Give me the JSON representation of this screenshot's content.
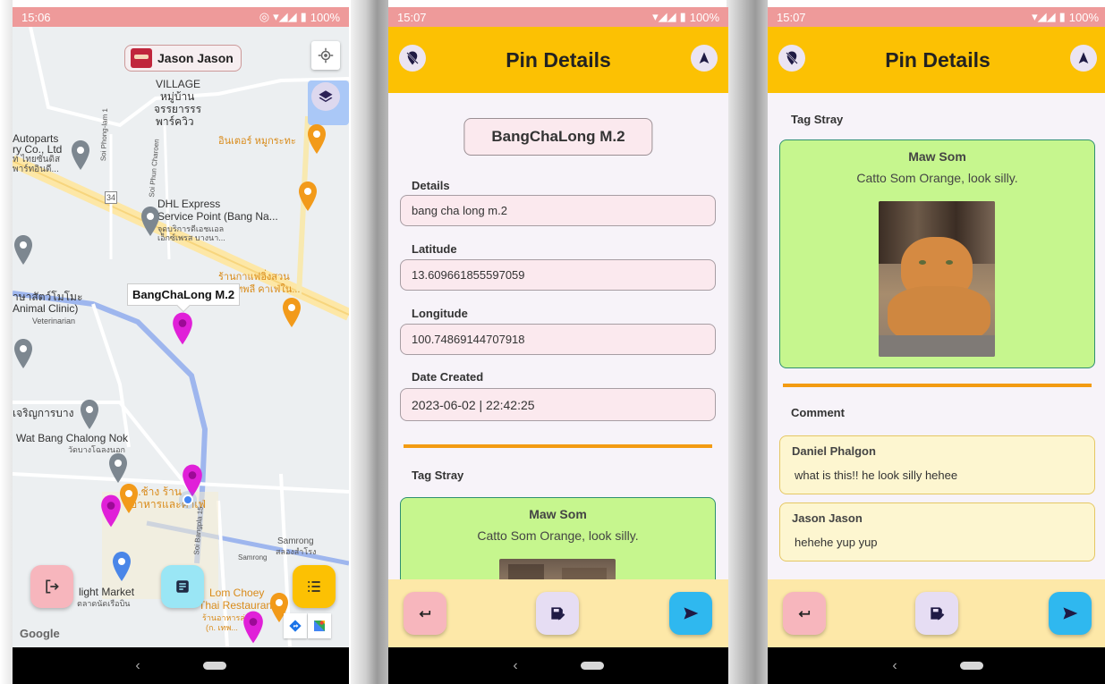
{
  "status": {
    "screen1_time": "15:06",
    "screen2_time": "15:07",
    "screen3_time": "15:07",
    "battery": "100%"
  },
  "map_screen": {
    "user_name": "Jason Jason",
    "pin_tooltip": "BangChaLong M.2",
    "labels": {
      "village": "VILLAGE",
      "village_th1": "หมู่บ้าน",
      "village_th2": "จรรยารรร",
      "village_th3": "พาร์ควิว",
      "autoparts1": "Autoparts",
      "autoparts2": "ry Co., Ltd",
      "autoparts3": "ท ไทยซันดิส",
      "autoparts4": "พาร์ทอินดี...",
      "dhl1": "DHL Express",
      "dhl2": "Service Point (Bang Na...",
      "dhl3": "จุดบริการดีเอชแอล",
      "dhl4": "เอ็กซ์เพรส บางนา...",
      "inter": "อินเตอร์ หมูกระทะ",
      "cafe1": "ร้านกาแฟอิ่งสวน",
      "cafe2": "ทพลี คาเฟ่ใน...",
      "animal1": "าษาสัตว์โมโมะ",
      "animal2": "Animal Clinic)",
      "animal3": "Veterinarian",
      "jaroen": "เจริญการบาง",
      "wat1": "Wat Bang Chalong Nok",
      "wat2": "วัดบางโฉลงนอก",
      "chang1": "ข.ช้าง ร้าน",
      "chang2": "อาหารและคาเฟ่",
      "samrong1": "Samrong",
      "samrong2": "สลองสำโรง",
      "samrong_road": "Samrong",
      "market1": "light Market",
      "market2": "ตลาดนัดเรือบิน",
      "lom1": "Lom Choey",
      "lom2": "Thai Restaurant...",
      "lom3": "ร้านอาหารล่ม",
      "lom4": "(ก. เทพ...",
      "soi1": "Soi Phong-lam 1",
      "soi2": "Soi Phun Charoen",
      "soi3": "Soi Bangpla 15",
      "road34": "34",
      "google": "Google"
    }
  },
  "pin_details": {
    "title": "Pin Details",
    "pin_name": "BangChaLong M.2",
    "details_label": "Details",
    "details_value": "bang cha long m.2",
    "latitude_label": "Latitude",
    "latitude_value": "13.609661855597059",
    "longitude_label": "Longitude",
    "longitude_value": "100.74869144707918",
    "date_label": "Date Created",
    "date_value": "2023-06-02 | 22:42:25",
    "tag_stray_label": "Tag Stray",
    "stray_name": "Maw Som",
    "stray_desc": "Catto Som Orange, look silly.",
    "comment_label": "Comment",
    "comments": [
      {
        "user": "Daniel Phalgon",
        "text": "what is this!! he look silly hehee"
      },
      {
        "user": "Jason Jason",
        "text": "hehehe yup yup"
      }
    ]
  },
  "colors": {
    "status_bar": "#ee9a9a",
    "app_bar": "#fcc103",
    "bottom_bar": "#fde8a8",
    "field_bg": "#fbe9ee",
    "stray_card": "#c6f68e",
    "comment_card": "#fdf6d0",
    "divider": "#f39b12",
    "pin_magenta": "#e020d8"
  },
  "icons": {
    "logout": "logout-icon",
    "note": "note-icon",
    "list": "list-icon",
    "back": "back-arrow-icon",
    "save": "save-edit-icon",
    "send": "send-icon",
    "navigate": "navigation-arrow-icon",
    "pin_off": "location-off-icon",
    "locate": "my-location-icon",
    "layers": "layers-icon"
  }
}
